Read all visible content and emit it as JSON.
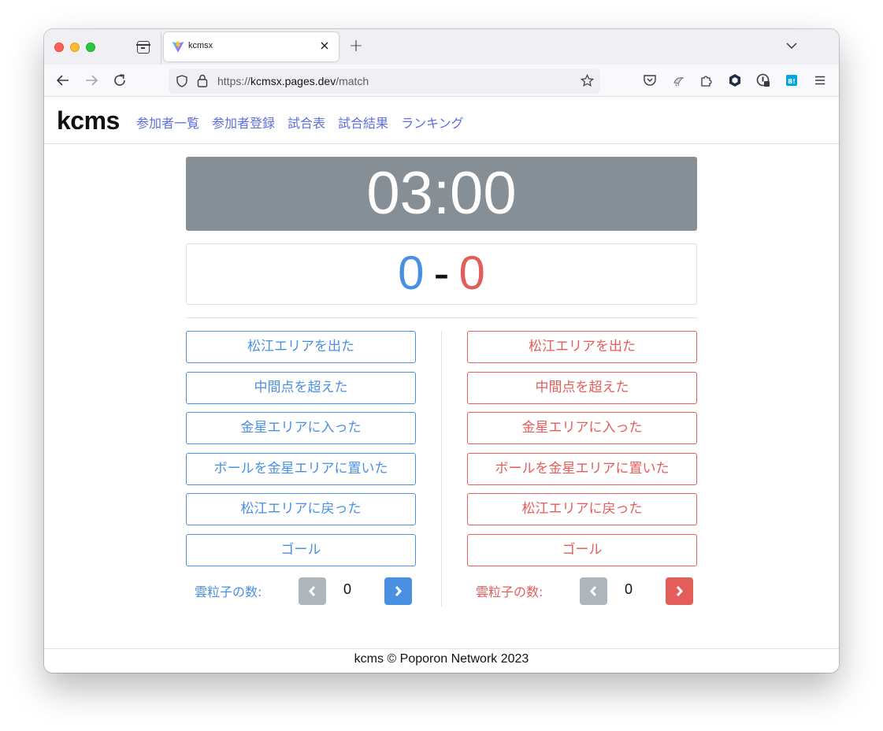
{
  "browser": {
    "tab_title": "kcmsx",
    "tab_close": "×",
    "new_tab": "+",
    "url_scheme": "https://",
    "url_host": "kcmsx.pages.dev",
    "url_path": "/match"
  },
  "site": {
    "brand": "kcms",
    "nav": [
      "参加者一覧",
      "参加者登録",
      "試合表",
      "試合結果",
      "ランキング"
    ]
  },
  "match": {
    "timer": "03:00",
    "score_left": "0",
    "score_separator": "-",
    "score_right": "0",
    "actions": [
      "松江エリアを出た",
      "中間点を超えた",
      "金星エリアに入った",
      "ボールを金星エリアに置いた",
      "松江エリアに戻った",
      "ゴール"
    ],
    "counter_label": "雲粒子の数:",
    "left_counter": "0",
    "right_counter": "0"
  },
  "footer": {
    "text": "kcms © Poporon Network 2023"
  },
  "colors": {
    "left_team": "#4a90e2",
    "right_team": "#e35d5b",
    "timer_bg": "#868e96",
    "nav_link": "#5d6fdc"
  }
}
